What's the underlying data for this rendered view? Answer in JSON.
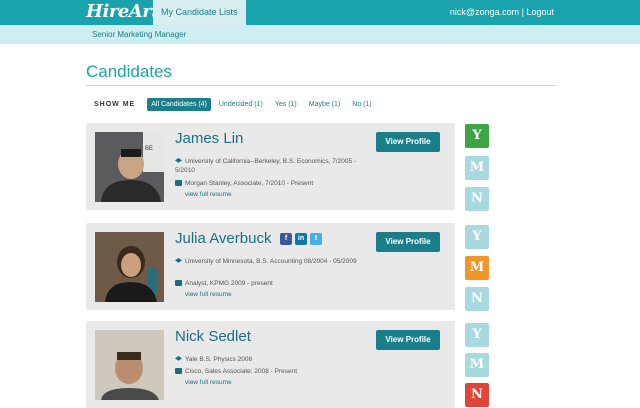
{
  "header": {
    "logo": "HireArt",
    "tab_label": "My Candidate Lists",
    "user_email": "nick@zonga.com",
    "separator": "|",
    "logout_label": "Logout"
  },
  "subheader": {
    "job_title": "Senior Marketing Manager"
  },
  "main": {
    "title": "Candidates",
    "filters": {
      "show_me": "SHOW ME",
      "items": [
        {
          "label": "All Candidates (4)",
          "active": true
        },
        {
          "label": "Undecided (1)",
          "active": false
        },
        {
          "label": "Yes (1)",
          "active": false
        },
        {
          "label": "Maybe (1)",
          "active": false
        },
        {
          "label": "No (1)",
          "active": false
        }
      ]
    },
    "candidates": [
      {
        "name": "James Lin",
        "education": "University of California--Berkeley, B.S. Economics, 7/2005 - 5/2010",
        "work": "Morgan Stanley, Associate, 7/2010 - Present",
        "resume_link": "view full resume",
        "button": "View Profile",
        "vote": "Y",
        "socials": []
      },
      {
        "name": "Julia Averbuck",
        "education": "University of Minnesota, B.S. Accounting 08/2004 - 05/2009",
        "work": "Analyst, KPMG 2009 - present",
        "resume_link": "view full resume",
        "button": "View Profile",
        "vote": "M",
        "socials": [
          "f",
          "in",
          "t"
        ]
      },
      {
        "name": "Nick Sedlet",
        "education": "Yale B.S. Physics 2008",
        "work": "Cisco, Sales Associate; 2008 - Present",
        "resume_link": "view full resume",
        "button": "View Profile",
        "vote": "N",
        "socials": []
      }
    ],
    "vote_labels": [
      "Y",
      "M",
      "N"
    ]
  },
  "colors": {
    "brand": "#1aa3ad",
    "yes": "#3fa544",
    "maybe": "#f0962a",
    "no": "#e0453a",
    "inactive_vote": "#a8d8e0"
  }
}
